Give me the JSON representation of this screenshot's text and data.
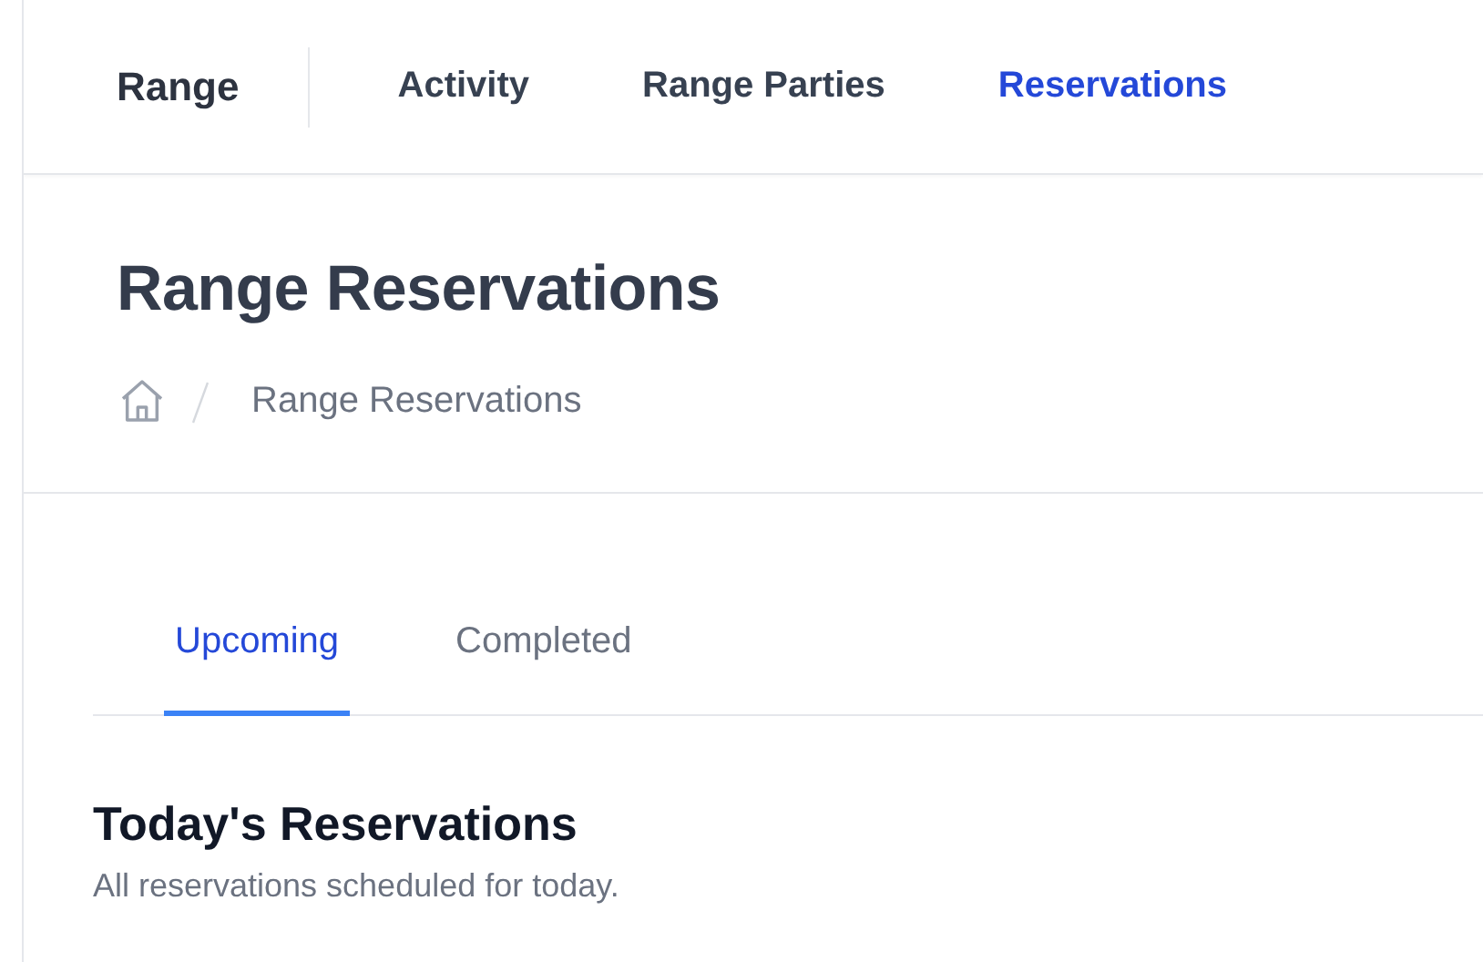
{
  "nav": {
    "brand": "Range",
    "links": [
      {
        "label": "Activity",
        "selected": false
      },
      {
        "label": "Range Parties",
        "selected": false
      },
      {
        "label": "Reservations",
        "selected": true
      }
    ]
  },
  "header": {
    "title": "Range Reservations",
    "breadcrumb": [
      "Range Reservations"
    ]
  },
  "tabs": [
    {
      "label": "Upcoming",
      "selected": true
    },
    {
      "label": "Completed",
      "selected": false
    }
  ],
  "section": {
    "title": "Today's Reservations",
    "subtitle": "All reservations scheduled for today."
  }
}
